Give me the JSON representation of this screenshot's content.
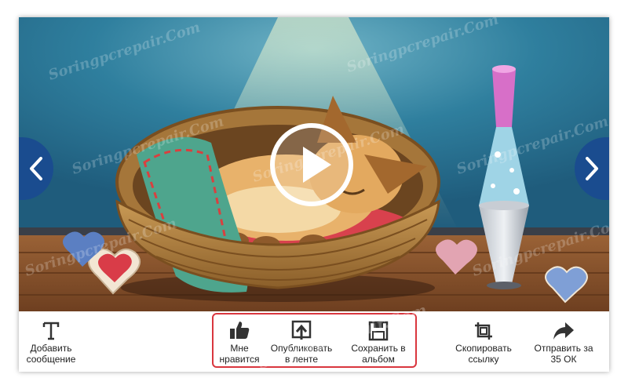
{
  "watermark": "Soringpcrepair.Com",
  "toolbar": {
    "add_message": "Добавить сообщение",
    "like": "Мне нравится",
    "publish_feed": "Опубликовать в ленте",
    "save_album": "Сохранить в альбом",
    "copy_link": "Скопировать ссылку",
    "send_ok": "Отправить за 35 ОК"
  },
  "colors": {
    "nav_blue": "#1a4c8f",
    "highlight_red": "#d9363e",
    "wall": "#2f7f9e",
    "floor": "#8a5530"
  },
  "icons": {
    "prev": "chevron-left-icon",
    "next": "chevron-right-icon",
    "play": "play-icon",
    "add_message": "text-t-icon",
    "like": "thumbs-up-icon",
    "publish_feed": "share-upload-icon",
    "save_album": "floppy-disk-icon",
    "copy_link": "crop-link-icon",
    "send_ok": "forward-arrow-icon"
  }
}
